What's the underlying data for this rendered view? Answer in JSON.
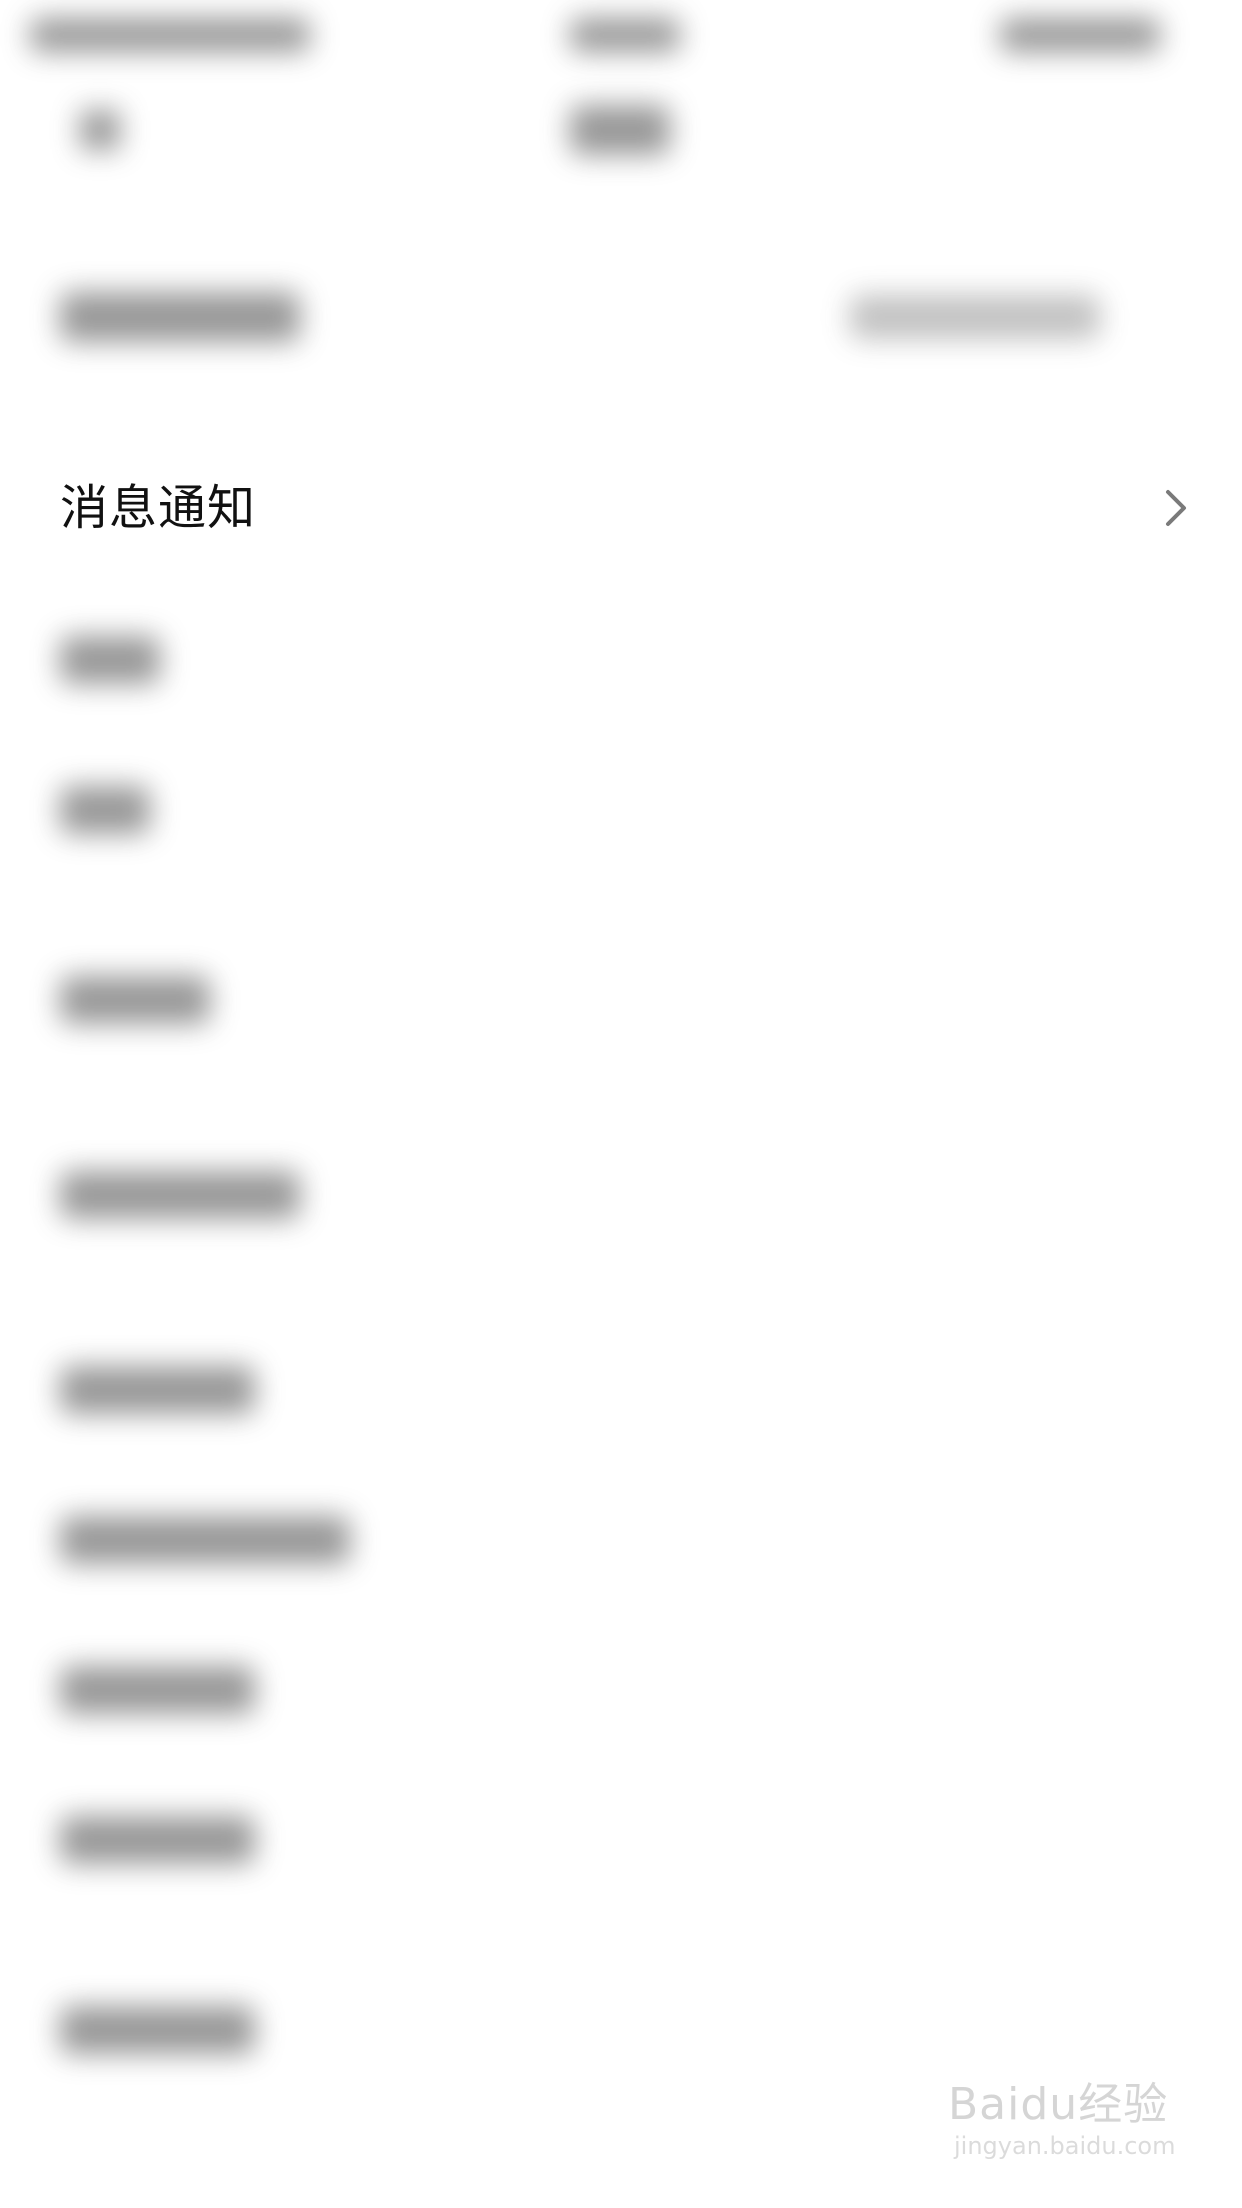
{
  "settings": {
    "notification_item": {
      "label": "消息通知",
      "chevron_icon": "chevron-right-icon"
    }
  },
  "watermark": {
    "brand": "Baidu经验",
    "url": "jingyan.baidu.com"
  },
  "colors": {
    "background": "#ffffff",
    "text": "#111111",
    "chevron": "#7a7a7a"
  }
}
